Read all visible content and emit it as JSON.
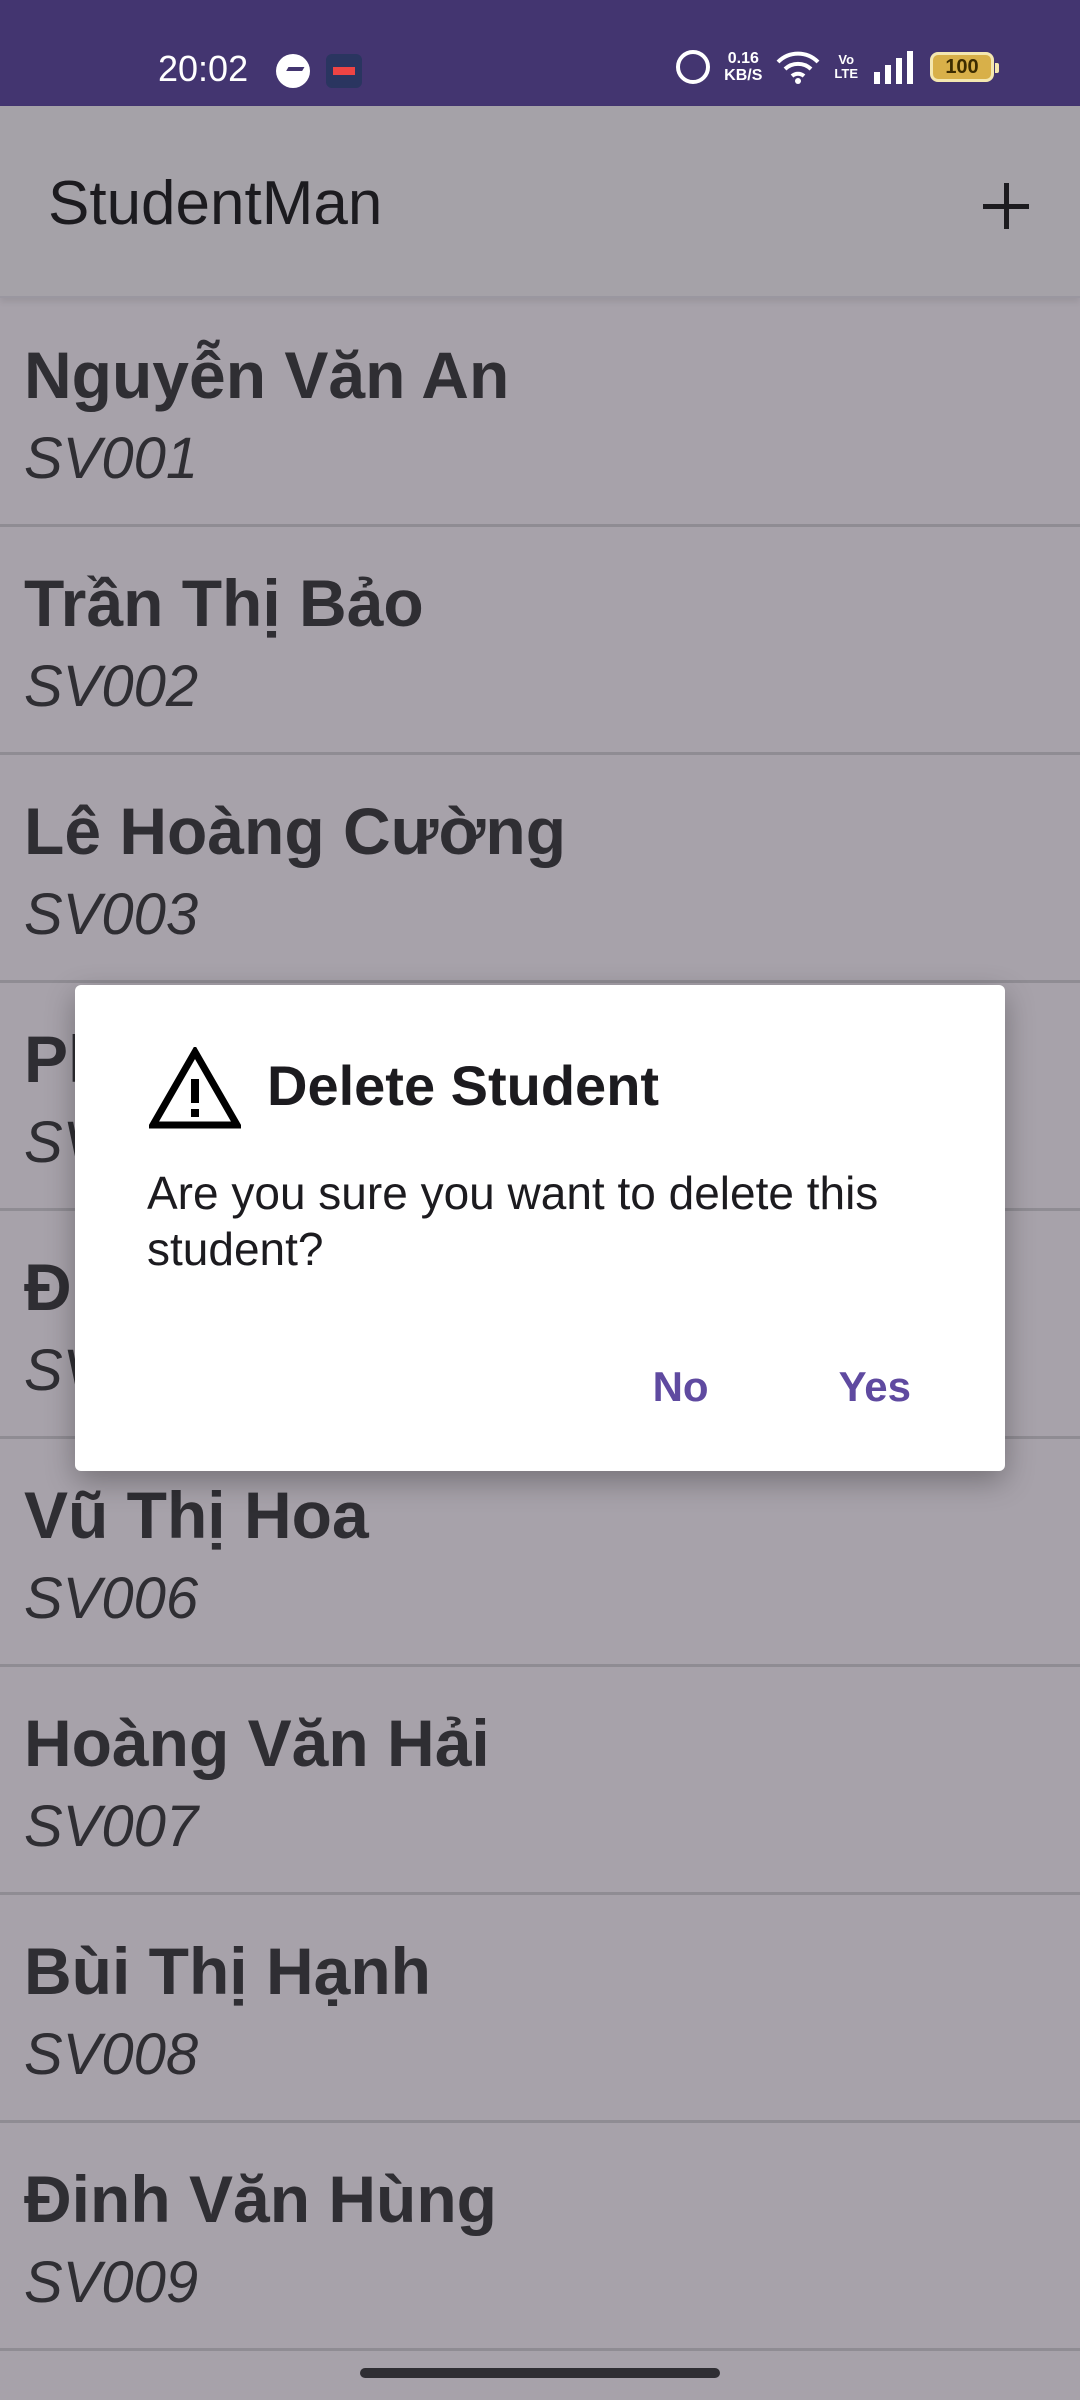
{
  "status_bar": {
    "time": "20:02",
    "net_speed_value": "0.16",
    "net_speed_unit": "KB/S",
    "volte_top": "Vo",
    "volte_bottom": "LTE",
    "battery": "100",
    "icons": [
      "messenger-icon",
      "app-icon",
      "alarm-icon",
      "wifi-icon",
      "signal-icon",
      "battery-icon"
    ]
  },
  "toolbar": {
    "title": "StudentMan",
    "add_icon": "plus-icon"
  },
  "students": [
    {
      "name": "Nguyễn Văn An",
      "id": "SV001"
    },
    {
      "name": "Trần Thị Bảo",
      "id": "SV002"
    },
    {
      "name": "Lê Hoàng Cường",
      "id": "SV003"
    },
    {
      "name": "Ph",
      "id": "SV"
    },
    {
      "name": "Đ",
      "id": "SV"
    },
    {
      "name": "Vũ Thị Hoa",
      "id": "SV006"
    },
    {
      "name": "Hoàng Văn Hải",
      "id": "SV007"
    },
    {
      "name": "Bùi Thị Hạnh",
      "id": "SV008"
    },
    {
      "name": "Đinh Văn Hùng",
      "id": "SV009"
    }
  ],
  "dialog": {
    "icon": "warning-icon",
    "title": "Delete Student",
    "message": "Are you sure you want to delete this student?",
    "no_label": "No",
    "yes_label": "Yes"
  },
  "colors": {
    "status_bar": "#433570",
    "scrim_background": "#a7a2aa",
    "dialog_button": "#5f4aa0"
  }
}
